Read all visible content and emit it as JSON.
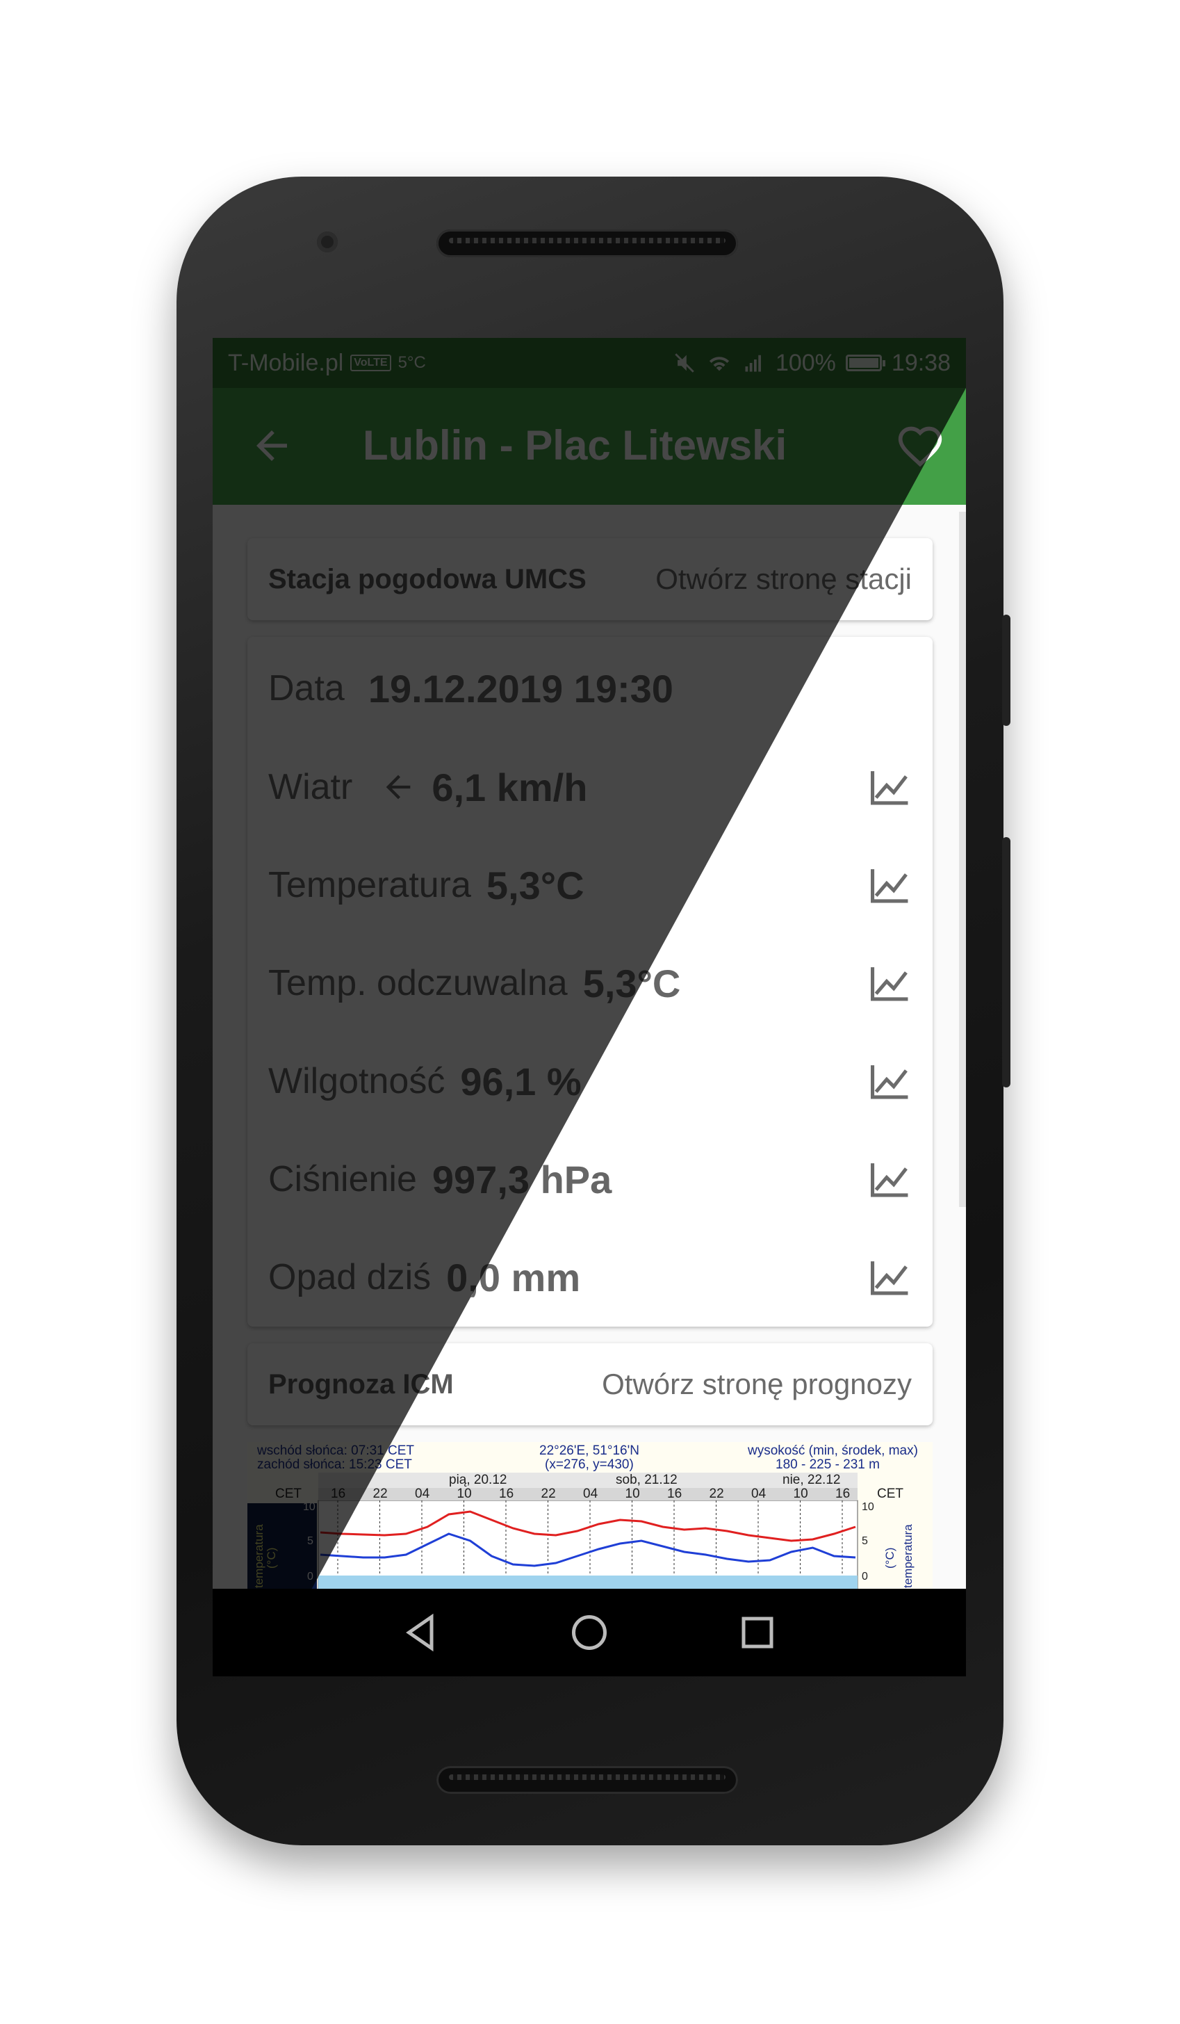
{
  "status_bar": {
    "carrier": "T-Mobile.pl",
    "volte": "VoLTE",
    "temp": "5°C",
    "battery": "100%",
    "time": "19:38"
  },
  "app_bar": {
    "title": "Lublin - Plac Litewski"
  },
  "station_card": {
    "name": "Stacja pogodowa UMCS",
    "link": "Otwórz stronę stacji"
  },
  "measurements": {
    "date_label": "Data",
    "date_value": "19.12.2019 19:30",
    "rows": [
      {
        "label": "Wiatr",
        "value": "6,1 km/h"
      },
      {
        "label": "Temperatura",
        "value": "5,3°C"
      },
      {
        "label": "Temp. odczuwalna",
        "value": "5,3°C"
      },
      {
        "label": "Wilgotność",
        "value": "96,1 %"
      },
      {
        "label": "Ciśnienie",
        "value": "997,3 hPa"
      },
      {
        "label": "Opad dziś",
        "value": "0,0 mm"
      }
    ]
  },
  "forecast_card": {
    "name": "Prognoza ICM",
    "link": "Otwórz stronę prognozy"
  },
  "meteogram": {
    "sunrise": "wschód słońca: 07:31 CET",
    "sunset": "zachód słońca: 15:23 CET",
    "coords": "22°26'E, 51°16'N",
    "grid": "(x=276,  y=430)",
    "elev_label": "wysokość (min, środek, max)",
    "elev_values": "180 - 225 - 231 m",
    "day1": "pią, 20.12",
    "day2": "sob, 21.12",
    "day3": "nie, 22.12",
    "tz": "CET",
    "hours": [
      "16",
      "22",
      "04",
      "10",
      "16",
      "22",
      "04",
      "10",
      "16",
      "22",
      "04",
      "10",
      "16"
    ],
    "axis_label": "temperatura",
    "axis_unit": "(°C)",
    "yticks": [
      "10",
      "5",
      "0"
    ],
    "colors": {
      "temp": "#e02020",
      "dew": "#1f3fd6"
    }
  }
}
